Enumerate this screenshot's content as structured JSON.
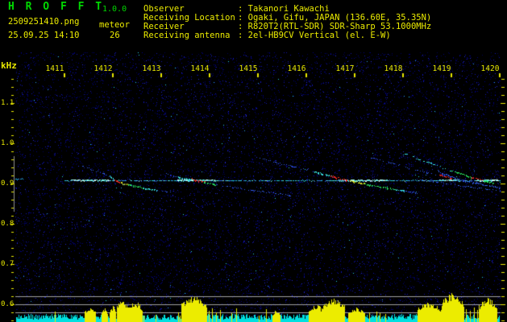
{
  "app": {
    "title": "H R O F F T",
    "version": "1.0.0",
    "file_name": "2509251410.png",
    "mode": "meteor",
    "datetime": "25.09.25 14:10",
    "meteor_count": "26"
  },
  "info": {
    "colon": ": ",
    "rows": [
      {
        "label": "Observer",
        "value": "Takanori Kawachi"
      },
      {
        "label": "Receiving Location",
        "value": "Ogaki, Gifu, JAPAN (136.60E, 35.35N)"
      },
      {
        "label": "Receiver",
        "value": "R820T2(RTL-SDR) SDR-Sharp 53.1000MHz"
      },
      {
        "label": "Receiving antenna",
        "value": "2el-HB9CV Vertical (el. E-W)"
      }
    ]
  },
  "chart_data": {
    "type": "heatmap",
    "subtype": "radio-meteor-spectrogram",
    "ylabel": "kHz",
    "x_units": "time (hhmm)",
    "x_range": [
      1410.0,
      1420.03
    ],
    "y_range_khz": [
      0.556,
      1.226
    ],
    "grid": false,
    "x_ticks": [
      {
        "t": 1411,
        "label": "1411"
      },
      {
        "t": 1412,
        "label": "1412"
      },
      {
        "t": 1413,
        "label": "1413"
      },
      {
        "t": 1414,
        "label": "1414"
      },
      {
        "t": 1415,
        "label": "1415"
      },
      {
        "t": 1416,
        "label": "1416"
      },
      {
        "t": 1417,
        "label": "1417"
      },
      {
        "t": 1418,
        "label": "1418"
      },
      {
        "t": 1419,
        "label": "1419"
      },
      {
        "t": 1420,
        "label": "1420"
      }
    ],
    "y_ticks": [
      {
        "f": 1.1,
        "label": "1.1"
      },
      {
        "f": 1.0,
        "label": "1.0"
      },
      {
        "f": 0.9,
        "label": "0.9"
      },
      {
        "f": 0.8,
        "label": "0.8"
      },
      {
        "f": 0.7,
        "label": "0.7"
      },
      {
        "f": 0.6,
        "label": "0.6"
      }
    ],
    "minor_tick_step_khz": 0.02,
    "ref_lines_khz": [
      0.62,
      0.6,
      0.58
    ],
    "marker_line": {
      "t": 1409.98,
      "f0": 0.83,
      "f1": 0.968
    },
    "carrier": {
      "f": 0.908,
      "t1": 1411.02,
      "t2": 1420.02,
      "stub": {
        "t1": 1409.98,
        "t2": 1410.15,
        "f": 0.912
      },
      "bright_segments": [
        [
          1411.15,
          1411.93
        ],
        [
          1413.35,
          1414.13
        ],
        [
          1416.68,
          1417.68
        ],
        [
          1418.77,
          1419.18
        ],
        [
          1419.52,
          1419.98
        ]
      ]
    },
    "traces": [
      [
        1411.35,
        0.946,
        1411.967,
        0.918,
        "blue",
        1
      ],
      [
        1411.967,
        0.918,
        1412.05,
        0.91,
        "cyan",
        0
      ],
      [
        1412.05,
        0.91,
        1412.167,
        0.904,
        "red",
        0
      ],
      [
        1412.167,
        0.904,
        1412.317,
        0.898,
        "yellow",
        0
      ],
      [
        1412.317,
        0.898,
        1412.65,
        0.89,
        "green",
        0
      ],
      [
        1412.65,
        0.89,
        1412.933,
        0.884,
        "cyan",
        0
      ],
      [
        1412.933,
        0.884,
        1413.217,
        0.878,
        "blue",
        1
      ],
      [
        1413.1,
        0.926,
        1413.35,
        0.916,
        "blue",
        1
      ],
      [
        1413.35,
        0.916,
        1413.65,
        0.91,
        "cyan",
        0
      ],
      [
        1413.65,
        0.912,
        1413.9,
        0.904,
        "red",
        0
      ],
      [
        1413.9,
        0.904,
        1414.133,
        0.898,
        "green",
        0
      ],
      [
        1414.133,
        0.898,
        1415.733,
        0.87,
        "blue",
        1
      ],
      [
        1415.017,
        0.964,
        1416.183,
        0.93,
        "blue",
        1
      ],
      [
        1416.183,
        0.93,
        1416.517,
        0.92,
        "cyan",
        0
      ],
      [
        1416.517,
        0.92,
        1416.9,
        0.908,
        "red",
        0
      ],
      [
        1416.9,
        0.908,
        1417.217,
        0.9,
        "yellow",
        0
      ],
      [
        1417.217,
        0.9,
        1417.85,
        0.886,
        "green",
        0
      ],
      [
        1417.85,
        0.886,
        1418.05,
        0.882,
        "cyan",
        0
      ],
      [
        1418.05,
        0.882,
        1418.3,
        0.876,
        "blue",
        1
      ],
      [
        1417.183,
        0.97,
        1418.767,
        0.92,
        "blue",
        1
      ],
      [
        1418.767,
        0.922,
        1419.017,
        0.914,
        "red",
        0
      ],
      [
        1418.05,
        0.974,
        1419.017,
        0.932,
        "cyan",
        1
      ],
      [
        1419.017,
        0.932,
        1419.433,
        0.916,
        "green",
        0
      ],
      [
        1419.433,
        0.916,
        1419.683,
        0.908,
        "red",
        0
      ],
      [
        1419.683,
        0.908,
        1419.883,
        0.902,
        "green",
        0
      ],
      [
        1418.467,
        0.954,
        1418.817,
        0.926,
        "blue",
        1
      ],
      [
        1418.817,
        0.926,
        1419.267,
        0.908,
        "blue",
        0
      ],
      [
        1419.267,
        0.908,
        1420.017,
        0.89,
        "blue",
        0
      ],
      [
        1418.35,
        0.91,
        1420.017,
        0.882,
        "blue",
        1
      ]
    ],
    "trace_colors": {
      "red": "#F02820",
      "yellow": "#D8E020",
      "green": "#28E060",
      "cyan": "#38E0E0",
      "blue": "#3058E8",
      "white": "#D8F0F0"
    },
    "activity_strip": {
      "noise_color": "#00E0E0",
      "event_color": "#ECEC00",
      "clusters": [
        [
          1411.433,
          1411.65,
          18
        ],
        [
          1411.783,
          1411.9,
          17
        ],
        [
          1411.95,
          1412.067,
          20
        ],
        [
          1412.1,
          1412.317,
          28
        ],
        [
          1412.333,
          1412.617,
          26
        ],
        [
          1413.433,
          1413.95,
          33
        ],
        [
          1415.317,
          1415.467,
          15
        ],
        [
          1416.067,
          1416.35,
          22
        ],
        [
          1416.35,
          1416.8,
          30
        ],
        [
          1416.883,
          1417.217,
          18
        ],
        [
          1418.317,
          1418.8,
          25
        ],
        [
          1418.817,
          1419.267,
          36
        ],
        [
          1419.583,
          1419.95,
          30
        ]
      ],
      "singles": [
        [
          1414.0,
          14
        ],
        [
          1414.067,
          17
        ],
        [
          1414.15,
          12
        ],
        [
          1414.233,
          15
        ],
        [
          1417.317,
          12
        ],
        [
          1417.467,
          13
        ],
        [
          1417.533,
          11
        ],
        [
          1419.317,
          16
        ],
        [
          1419.4,
          14
        ],
        [
          1419.483,
          18
        ],
        [
          1419.55,
          15
        ]
      ]
    },
    "noise": {
      "seed": 20250925,
      "dot_count": 12500,
      "bright_count": 150
    },
    "colors": {
      "axis": "#E8E800",
      "ref_line": "#A0A0A0",
      "marker": "#909090",
      "carrier": "#20C8D8",
      "carrier_bright": "#C8F8F0"
    }
  }
}
